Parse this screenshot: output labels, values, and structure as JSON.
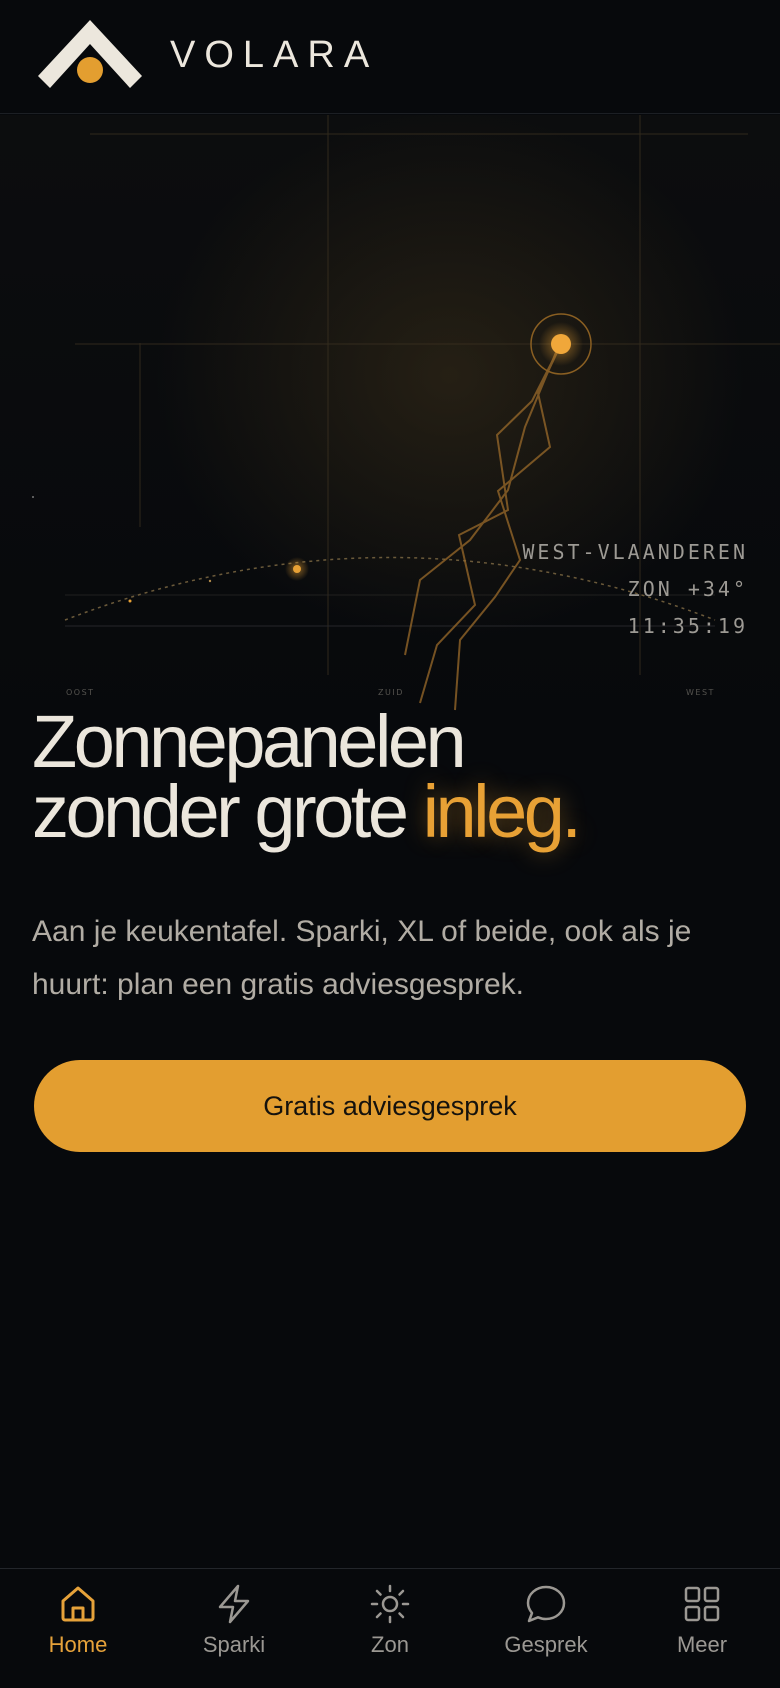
{
  "brand": {
    "name": "VOLARA",
    "logo_icon": "volara-logo-icon"
  },
  "hero": {
    "region": "WEST-VLAANDEREN",
    "sun_altitude": "ZON +34°",
    "time": "11:35:19",
    "axis_labels": {
      "east": "OOST",
      "south": "ZUID",
      "west": "WEST"
    },
    "headline_line1": "Zonnepanelen",
    "headline_line2_prefix": "zonder grote ",
    "headline_accent": "inleg.",
    "subtext": "Aan je keukentafel. Sparki, XL of beide, ook als je huurt: plan een gratis adviesgesprek.",
    "cta_label": "Gratis adviesgesprek"
  },
  "nav": {
    "items": [
      {
        "label": "Home",
        "icon": "home-icon",
        "active": true
      },
      {
        "label": "Sparki",
        "icon": "lightning-icon",
        "active": false
      },
      {
        "label": "Zon",
        "icon": "sun-icon",
        "active": false
      },
      {
        "label": "Gesprek",
        "icon": "chat-icon",
        "active": false
      },
      {
        "label": "Meer",
        "icon": "grid-icon",
        "active": false
      }
    ]
  },
  "colors": {
    "background": "#07090c",
    "accent": "#e39e30",
    "text": "#ebe6dc",
    "muted": "#b1aca4"
  }
}
